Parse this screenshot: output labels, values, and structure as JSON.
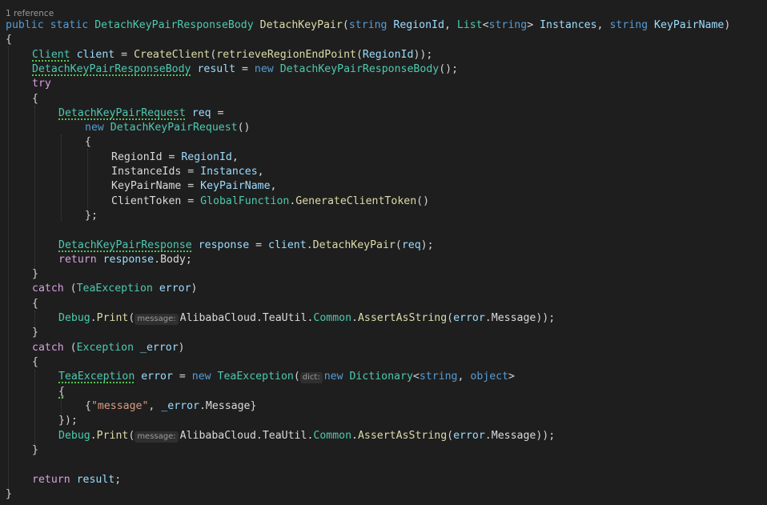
{
  "codelens": {
    "references": "1 reference"
  },
  "hints": {
    "message": "message:",
    "dict": "dict:"
  },
  "tokens": {
    "public": "public",
    "static": "static",
    "string": "string",
    "List": "List",
    "new": "new",
    "try": "try",
    "catch": "catch",
    "return": "return",
    "object": "object",
    "DetachKeyPairResponseBody": "DetachKeyPairResponseBody",
    "DetachKeyPair": "DetachKeyPair",
    "RegionId": "RegionId",
    "Instances": "Instances",
    "KeyPairName": "KeyPairName",
    "Client": "Client",
    "client": "client",
    "CreateClient": "CreateClient",
    "retrieveRegionEndPoint": "retrieveRegionEndPoint",
    "result": "result",
    "DetachKeyPairRequest": "DetachKeyPairRequest",
    "req": "req",
    "InstanceIds": "InstanceIds",
    "ClientToken": "ClientToken",
    "GlobalFunction": "GlobalFunction",
    "GenerateClientToken": "GenerateClientToken",
    "DetachKeyPairResponse": "DetachKeyPairResponse",
    "response": "response",
    "Body": "Body",
    "TeaException": "TeaException",
    "error": "error",
    "Debug": "Debug",
    "Print": "Print",
    "AlibabaCloud": "AlibabaCloud",
    "TeaUtil": "TeaUtil",
    "Common": "Common",
    "AssertAsString": "AssertAsString",
    "Message": "Message",
    "Exception": "Exception",
    "_error": "_error",
    "Dictionary": "Dictionary",
    "messageStr": "\"message\""
  }
}
